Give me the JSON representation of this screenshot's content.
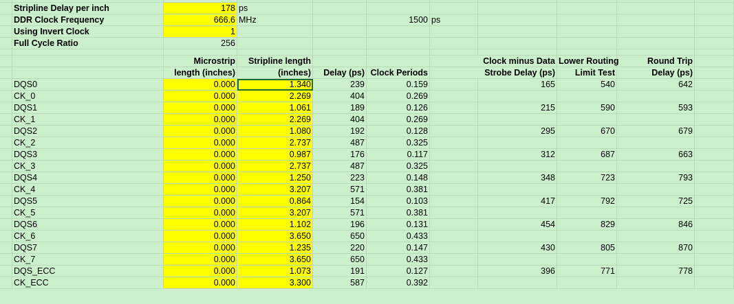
{
  "params": [
    {
      "label": "Stripline Delay per inch",
      "value": "178",
      "unit": "ps",
      "highlight": true
    },
    {
      "label": "DDR Clock Frequency",
      "value": "666.6",
      "unit": "MHz",
      "highlight": true,
      "extra_value": "1500",
      "extra_unit": "ps"
    },
    {
      "label": "Using Invert Clock",
      "value": "1",
      "unit": "",
      "highlight": true
    },
    {
      "label": "Full Cycle Ratio",
      "value": "256",
      "unit": "",
      "highlight": false
    }
  ],
  "headers": {
    "microstrip": [
      "Microstrip",
      "length (inches)"
    ],
    "stripline": [
      "Stripline length",
      "(inches)"
    ],
    "delay": [
      "",
      "Delay (ps)"
    ],
    "clock_periods": [
      "",
      "Clock Periods"
    ],
    "clock_minus": [
      "Clock minus Data",
      "Strobe Delay (ps)"
    ],
    "lower_routing": [
      "Lower Routing",
      "Limit Test"
    ],
    "round_trip": [
      "Round Trip",
      "Delay (ps)"
    ]
  },
  "rows": [
    {
      "name": "DQS0",
      "microstrip": "0.000",
      "stripline": "1.340",
      "delay": "239",
      "clock_periods": "0.159",
      "clock_minus": "165",
      "lower_routing": "540",
      "round_trip": "642"
    },
    {
      "name": "CK_0",
      "microstrip": "0.000",
      "stripline": "2.269",
      "delay": "404",
      "clock_periods": "0.269",
      "clock_minus": "",
      "lower_routing": "",
      "round_trip": ""
    },
    {
      "name": "DQS1",
      "microstrip": "0.000",
      "stripline": "1.061",
      "delay": "189",
      "clock_periods": "0.126",
      "clock_minus": "215",
      "lower_routing": "590",
      "round_trip": "593"
    },
    {
      "name": "CK_1",
      "microstrip": "0.000",
      "stripline": "2.269",
      "delay": "404",
      "clock_periods": "0.269",
      "clock_minus": "",
      "lower_routing": "",
      "round_trip": ""
    },
    {
      "name": "DQS2",
      "microstrip": "0.000",
      "stripline": "1.080",
      "delay": "192",
      "clock_periods": "0.128",
      "clock_minus": "295",
      "lower_routing": "670",
      "round_trip": "679"
    },
    {
      "name": "CK_2",
      "microstrip": "0.000",
      "stripline": "2.737",
      "delay": "487",
      "clock_periods": "0.325",
      "clock_minus": "",
      "lower_routing": "",
      "round_trip": ""
    },
    {
      "name": "DQS3",
      "microstrip": "0.000",
      "stripline": "0.987",
      "delay": "176",
      "clock_periods": "0.117",
      "clock_minus": "312",
      "lower_routing": "687",
      "round_trip": "663"
    },
    {
      "name": "CK_3",
      "microstrip": "0.000",
      "stripline": "2.737",
      "delay": "487",
      "clock_periods": "0.325",
      "clock_minus": "",
      "lower_routing": "",
      "round_trip": ""
    },
    {
      "name": "DQS4",
      "microstrip": "0.000",
      "stripline": "1.250",
      "delay": "223",
      "clock_periods": "0.148",
      "clock_minus": "348",
      "lower_routing": "723",
      "round_trip": "793"
    },
    {
      "name": "CK_4",
      "microstrip": "0.000",
      "stripline": "3.207",
      "delay": "571",
      "clock_periods": "0.381",
      "clock_minus": "",
      "lower_routing": "",
      "round_trip": ""
    },
    {
      "name": "DQS5",
      "microstrip": "0.000",
      "stripline": "0.864",
      "delay": "154",
      "clock_periods": "0.103",
      "clock_minus": "417",
      "lower_routing": "792",
      "round_trip": "725"
    },
    {
      "name": "CK_5",
      "microstrip": "0.000",
      "stripline": "3.207",
      "delay": "571",
      "clock_periods": "0.381",
      "clock_minus": "",
      "lower_routing": "",
      "round_trip": ""
    },
    {
      "name": "DQS6",
      "microstrip": "0.000",
      "stripline": "1.102",
      "delay": "196",
      "clock_periods": "0.131",
      "clock_minus": "454",
      "lower_routing": "829",
      "round_trip": "846"
    },
    {
      "name": "CK_6",
      "microstrip": "0.000",
      "stripline": "3.650",
      "delay": "650",
      "clock_periods": "0.433",
      "clock_minus": "",
      "lower_routing": "",
      "round_trip": ""
    },
    {
      "name": "DQS7",
      "microstrip": "0.000",
      "stripline": "1.235",
      "delay": "220",
      "clock_periods": "0.147",
      "clock_minus": "430",
      "lower_routing": "805",
      "round_trip": "870"
    },
    {
      "name": "CK_7",
      "microstrip": "0.000",
      "stripline": "3.650",
      "delay": "650",
      "clock_periods": "0.433",
      "clock_minus": "",
      "lower_routing": "",
      "round_trip": ""
    },
    {
      "name": "DQS_ECC",
      "microstrip": "0.000",
      "stripline": "1.073",
      "delay": "191",
      "clock_periods": "0.127",
      "clock_minus": "396",
      "lower_routing": "771",
      "round_trip": "778"
    },
    {
      "name": "CK_ECC",
      "microstrip": "0.000",
      "stripline": "3.300",
      "delay": "587",
      "clock_periods": "0.392",
      "clock_minus": "",
      "lower_routing": "",
      "round_trip": ""
    }
  ],
  "colors": {
    "background": "#ccefcc",
    "highlight": "#ffff00",
    "gridline": "#b9d9b9",
    "selection": "#1e6b2f"
  }
}
